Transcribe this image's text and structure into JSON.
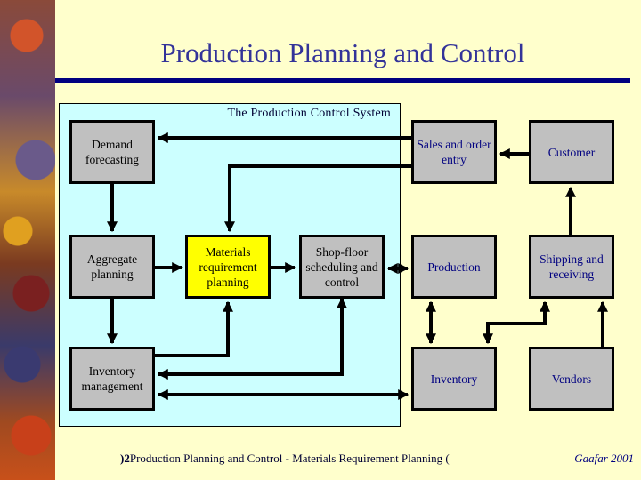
{
  "slide": {
    "title": "Production Planning and Control",
    "colors": {
      "background": "#FFFFCC",
      "title": "#333399",
      "rule": "#000080",
      "panel": "#CCFFFF",
      "box": "#C0C0C0",
      "highlight_box": "#FFFF00",
      "outside_text": "#000080"
    }
  },
  "diagram": {
    "panel_label": "The Production Control System",
    "inside_boxes": {
      "demand_forecasting": "Demand forecasting",
      "aggregate_planning": "Aggregate planning",
      "inventory_management": "Inventory management",
      "mrp": "Materials requirement planning",
      "shop_floor": "Shop-floor scheduling and control"
    },
    "outside_boxes": {
      "sales_order_entry": "Sales and order entry",
      "customer": "Customer",
      "production": "Production",
      "shipping_receiving": "Shipping and receiving",
      "inventory": "Inventory",
      "vendors": "Vendors"
    },
    "connections": [
      {
        "from": "Sales and order entry",
        "to": "Demand forecasting"
      },
      {
        "from": "Sales and order entry",
        "to": "Materials requirement planning"
      },
      {
        "from": "Customer",
        "to": "Sales and order entry"
      },
      {
        "from": "Shipping and receiving",
        "to": "Customer"
      },
      {
        "from": "Demand forecasting",
        "to": "Aggregate planning"
      },
      {
        "from": "Aggregate planning",
        "to": "Materials requirement planning"
      },
      {
        "from": "Aggregate planning",
        "to": "Inventory management"
      },
      {
        "from": "Materials requirement planning",
        "to": "Shop-floor scheduling and control"
      },
      {
        "from": "Inventory management",
        "to": "Materials requirement planning"
      },
      {
        "from": "Shop-floor scheduling and control",
        "to": "Inventory management"
      },
      {
        "from": "Shop-floor scheduling and control",
        "to": "Production",
        "bidirectional": true
      },
      {
        "from": "Inventory management",
        "to": "Inventory",
        "bidirectional": true
      },
      {
        "from": "Production",
        "to": "Inventory",
        "bidirectional": true
      },
      {
        "from": "Inventory",
        "to": "Shipping and receiving",
        "bidirectional": true
      },
      {
        "from": "Vendors",
        "to": "Shipping and receiving"
      }
    ]
  },
  "footer": {
    "prefix": ")2",
    "text": "Production Planning and Control - Materials Requirement Planning (",
    "author": "Gaafar 2001"
  }
}
